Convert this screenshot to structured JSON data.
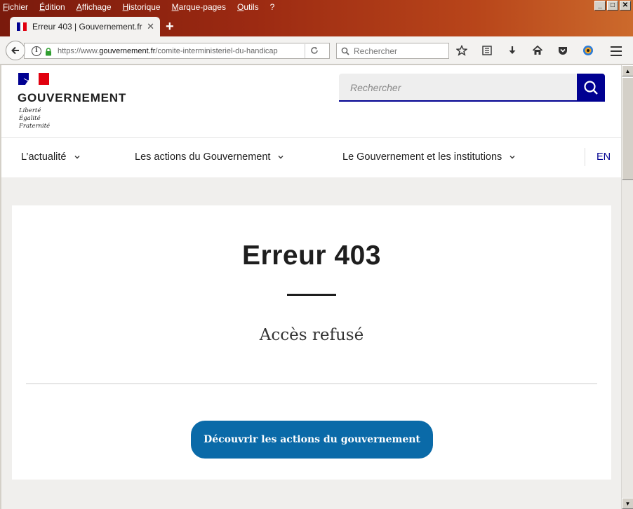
{
  "browser": {
    "menu": [
      "Fichier",
      "Édition",
      "Affichage",
      "Historique",
      "Marque-pages",
      "Outils",
      "?"
    ],
    "tab_title": "Erreur 403 | Gouvernement.fr",
    "new_tab": "+",
    "url_prefix": "https://www.",
    "url_domain": "gouvernement.fr",
    "url_path": "/comite-interministeriel-du-handicap",
    "search_placeholder": "Rechercher"
  },
  "site": {
    "brand": "GOUVERNEMENT",
    "motto": [
      "Liberté",
      "Égalité",
      "Fraternité"
    ],
    "search_placeholder": "Rechercher",
    "nav": [
      "L’actualité",
      "Les actions du Gouvernement",
      "Le Gouvernement et les institutions"
    ],
    "lang": "EN"
  },
  "error": {
    "title": "Erreur 403",
    "subtitle": "Accès refusé",
    "cta": "Découvrir les actions du gouvernement"
  },
  "colors": {
    "brand_blue": "#000091",
    "brand_red": "#e1000f",
    "cta_blue": "#0a6aa8"
  }
}
